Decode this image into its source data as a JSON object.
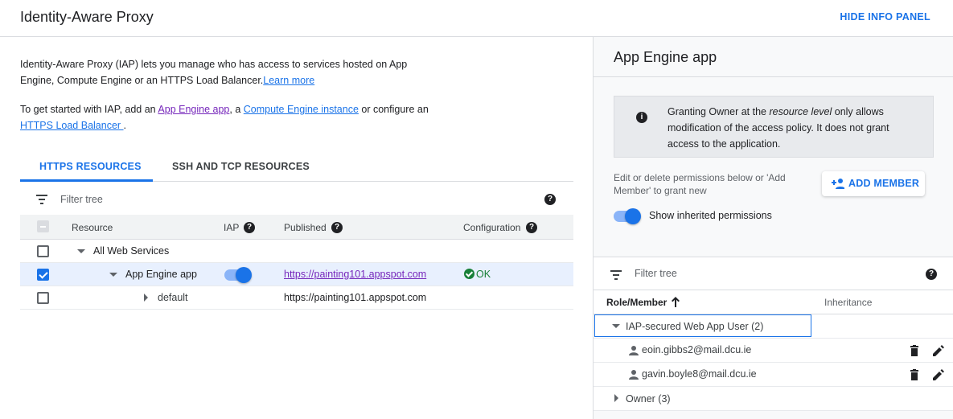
{
  "header": {
    "title": "Identity-Aware Proxy",
    "hide_info_panel": "HIDE INFO PANEL"
  },
  "intro": {
    "text": "Identity-Aware Proxy (IAP) lets you manage who has access to services hosted on App Engine, Compute Engine or an HTTPS Load Balancer.",
    "learn_more": "Learn more"
  },
  "get_started": {
    "prefix": "To get started with IAP, add an ",
    "app_engine_link": "App Engine app",
    "sep1": ", a ",
    "compute_link": "Compute Engine instance",
    "sep2": " or configure an ",
    "lb_link": "HTTPS Load Balancer ",
    "suffix": "."
  },
  "tabs": [
    {
      "label": "HTTPS RESOURCES",
      "active": true
    },
    {
      "label": "SSH AND TCP RESOURCES",
      "active": false
    }
  ],
  "filter": {
    "placeholder": "Filter tree"
  },
  "table": {
    "columns": {
      "resource": "Resource",
      "iap": "IAP",
      "published": "Published",
      "configuration": "Configuration"
    },
    "rows": [
      {
        "name": "All Web Services",
        "published": "",
        "configuration": ""
      },
      {
        "name": "App Engine app",
        "published": "https://painting101.appspot.com",
        "configuration": "OK",
        "iap_enabled": true
      },
      {
        "name": "default",
        "published": "https://painting101.appspot.com",
        "configuration": ""
      }
    ]
  },
  "panel": {
    "title": "App Engine app",
    "info": {
      "part1": "Granting Owner at the ",
      "emph": "resource level",
      "part2": " only allows modification of the access policy. It does not grant access to the application."
    },
    "edit_hint": "Edit or delete permissions below or 'Add Member' to grant new",
    "add_member": "ADD MEMBER",
    "show_inherited": "Show inherited permissions",
    "show_inherited_on": true,
    "filter_placeholder": "Filter tree",
    "columns": {
      "role_member": "Role/Member",
      "inheritance": "Inheritance"
    },
    "groups": [
      {
        "label": "IAP-secured Web App User (2)",
        "expanded": true,
        "members": [
          "eoin.gibbs2@mail.dcu.ie",
          "gavin.boyle8@mail.dcu.ie"
        ]
      },
      {
        "label": "Owner (3)",
        "expanded": false,
        "members": []
      }
    ]
  },
  "colors": {
    "accent": "#1a73e8",
    "ok": "#188038",
    "visited": "#7627bb"
  }
}
